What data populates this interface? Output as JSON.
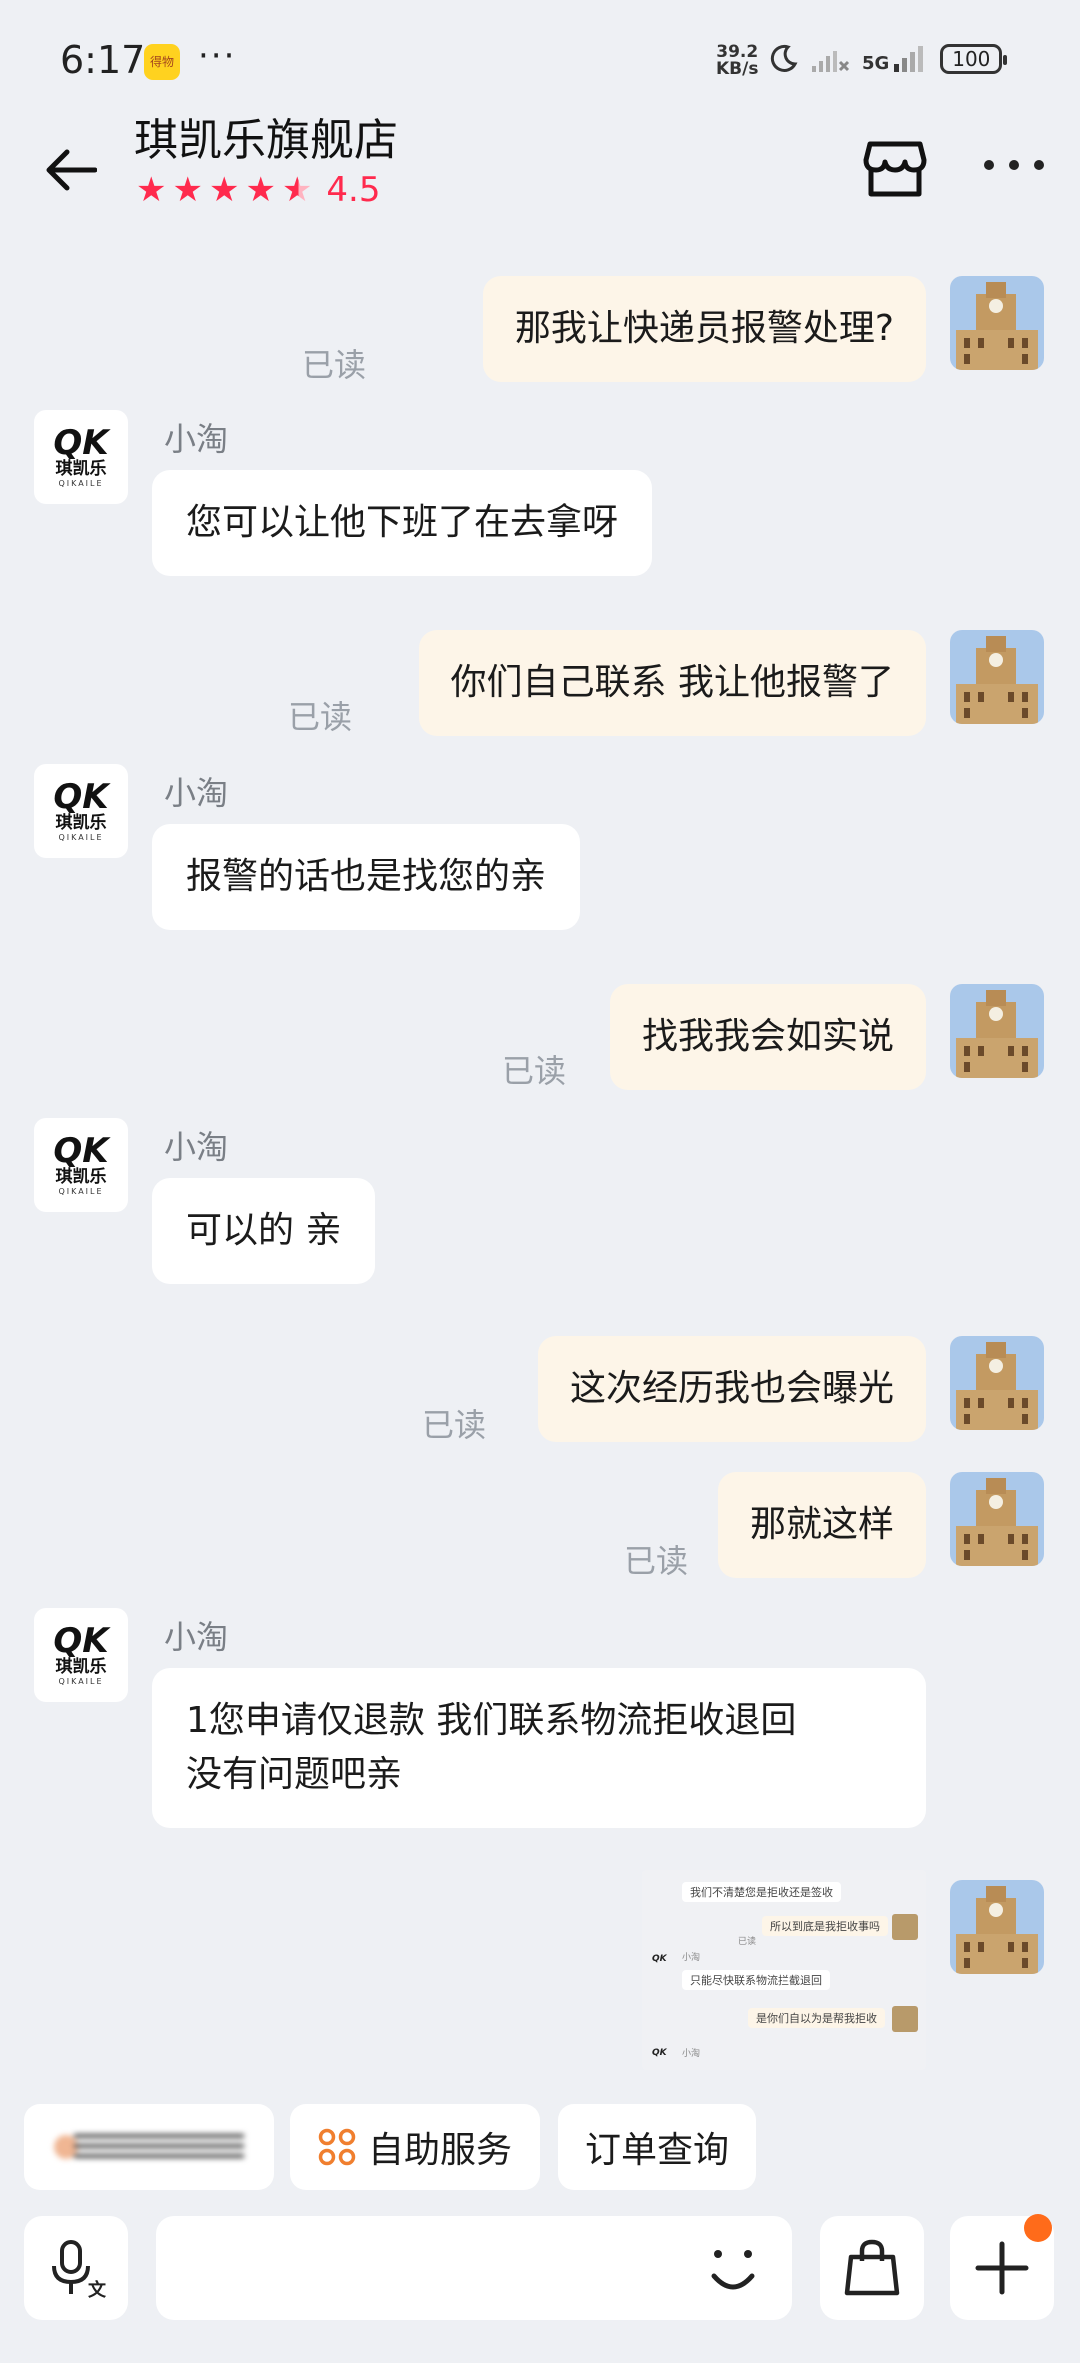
{
  "status_bar": {
    "time": "6:17",
    "app_badge": "得物",
    "more": "···",
    "net_speed_value": "39.2",
    "net_speed_unit": "KB/s",
    "network": "5G",
    "battery": "100"
  },
  "header": {
    "title": "琪凯乐旗舰店",
    "rating": "4.5",
    "rating_fraction": 0.9
  },
  "shop_avatar": {
    "mark": "QK",
    "name": "琪凯乐",
    "en": "QIKAILE"
  },
  "messages": [
    {
      "text": "那我让快递员报警处理?",
      "read": "已读"
    },
    {
      "sender": "小淘",
      "text": "您可以让他下班了在去拿呀"
    },
    {
      "text": "你们自己联系 我让他报警了",
      "read": "已读"
    },
    {
      "sender": "小淘",
      "text": "报警的话也是找您的亲"
    },
    {
      "text": "找我我会如实说",
      "read": "已读"
    },
    {
      "sender": "小淘",
      "text": "可以的 亲"
    },
    {
      "text": "这次经历我也会曝光",
      "read": "已读"
    },
    {
      "text": "那就这样",
      "read": "已读"
    },
    {
      "sender": "小淘",
      "text_line1": "1您申请仅退款 我们联系物流拒收退回",
      "text_line2": "没有问题吧亲"
    }
  ],
  "thumbnail": {
    "line1": "我们不清楚您是拒收还是签收",
    "line2": "所以到底是我拒收事吗",
    "read": "已读",
    "sender": "小淘",
    "line3": "只能尽快联系物流拦截退回",
    "line4": "是你们自以为是帮我拒收",
    "sender2": "小淘"
  },
  "quick_chips": {
    "self_service": "自助服务",
    "order_query": "订单查询"
  },
  "colors": {
    "accent": "#ff2a4d",
    "out_bubble": "#fdf5e8",
    "background": "#eef0f4",
    "notify": "#ff6b1a"
  }
}
